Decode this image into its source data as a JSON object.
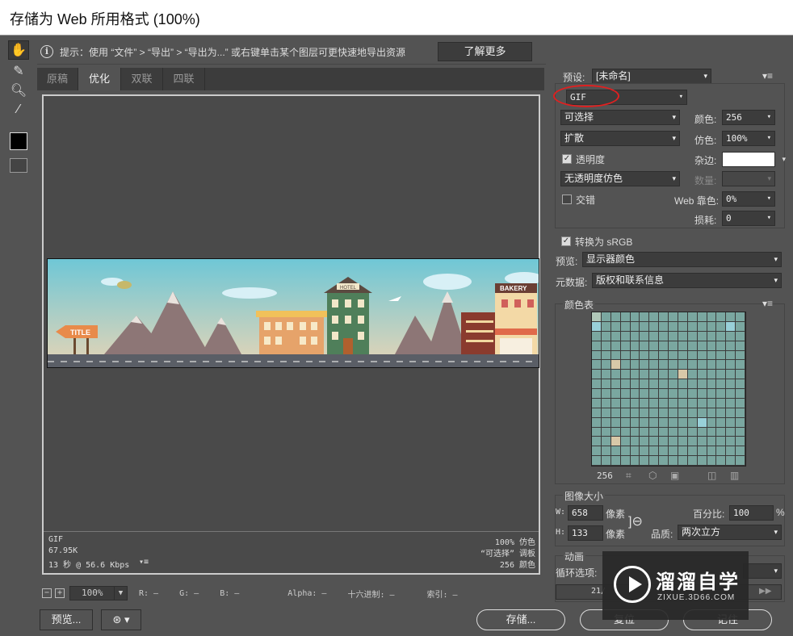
{
  "window": {
    "title": "存储为 Web 所用格式 (100%)"
  },
  "hint": {
    "text": "提示：使用 “文件” > “导出” > “导出为...” 或右键单击某个图层可更快速地导出资源",
    "button": "了解更多"
  },
  "tabs": [
    "原稿",
    "优化",
    "双联",
    "四联"
  ],
  "active_tab": "优化",
  "image": {
    "banner_sign": "TITLE",
    "hotel_sign": "HOTEL",
    "bakery_sign": "BAKERY"
  },
  "info": {
    "format": "GIF",
    "size": "67.95K",
    "time": "13 秒 @ 56.6 Kbps",
    "dither": "100% 仿色",
    "palette": "“可选择” 调板",
    "colors": "256 颜色"
  },
  "statusbar": {
    "zoom": "100%",
    "r": "R: —",
    "g": "G: —",
    "b": "B: —",
    "alpha": "Alpha: —",
    "hex": "十六进制: —",
    "index": "索引: —"
  },
  "buttons": {
    "preview": "预览...",
    "save": "存储...",
    "reset": "复位",
    "remember": "记住"
  },
  "settings": {
    "preset_label": "预设:",
    "preset_value": "[未命名]",
    "format": "GIF",
    "reduction": "可选择",
    "dither_algo": "扩散",
    "colors_label": "颜色:",
    "colors_value": "256",
    "dither_label": "仿色:",
    "dither_value": "100%",
    "transparency": "透明度",
    "matte_label": "杂边:",
    "trans_dither": "无透明度仿色",
    "amount_label": "数量:",
    "interlaced": "交错",
    "websnap_label": "Web 靠色:",
    "websnap_value": "0%",
    "lossy_label": "损耗:",
    "lossy_value": "0",
    "convert_srgb": "转换为 sRGB",
    "preview_label": "预览:",
    "preview_value": "显示器颜色",
    "metadata_label": "元数据:",
    "metadata_value": "版权和联系信息"
  },
  "color_table": {
    "title": "颜色表",
    "count": "256"
  },
  "image_size": {
    "title": "图像大小",
    "w_label": "W:",
    "w": "658",
    "h_label": "H:",
    "h": "133",
    "unit": "像素",
    "percent_label": "百分比:",
    "percent": "100",
    "percent_unit": "%",
    "quality_label": "品质:",
    "quality": "两次立方"
  },
  "animation": {
    "title": "动画",
    "loop_label": "循环选项:",
    "frame": "21/"
  },
  "watermark": {
    "title": "溜溜自学",
    "url": "ZIXUE.3D66.COM"
  }
}
